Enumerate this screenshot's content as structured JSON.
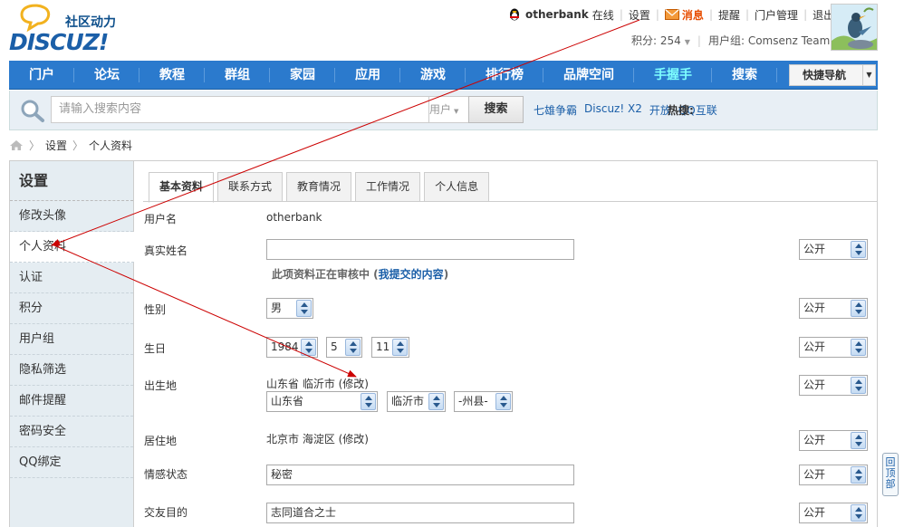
{
  "logo": {
    "tagline": "社区动力",
    "wordmark": "DISCUZ!"
  },
  "topbar": {
    "username": "otherbank",
    "online": "在线",
    "settings": "设置",
    "messages": "消息",
    "reminders": "提醒",
    "portal_manage": "门户管理",
    "logout": "退出"
  },
  "userinfo": {
    "points_label": "积分: 254",
    "usergroup_label": "用户组: Comsenz Team"
  },
  "nav": {
    "items": [
      "门户",
      "论坛",
      "教程",
      "群组",
      "家园",
      "应用",
      "游戏",
      "排行榜",
      "品牌空间",
      "手握手",
      "搜索"
    ],
    "quick_nav": "快捷导航"
  },
  "search": {
    "placeholder": "请输入搜索内容",
    "type": "用户",
    "button": "搜索",
    "hot_label": "热搜:",
    "hot_words": [
      "七雄争霸",
      "Discuz! X2",
      "开放",
      "QQ互联"
    ]
  },
  "breadcrumb": {
    "items": [
      "设置",
      "个人资料"
    ]
  },
  "sidebar": {
    "title": "设置",
    "items": [
      "修改头像",
      "个人资料",
      "认证",
      "积分",
      "用户组",
      "隐私筛选",
      "邮件提醒",
      "密码安全",
      "QQ绑定"
    ],
    "active_index": 1
  },
  "tabs": [
    "基本资料",
    "联系方式",
    "教育情况",
    "工作情况",
    "个人信息"
  ],
  "form": {
    "username": {
      "label": "用户名",
      "value": "otherbank"
    },
    "realname": {
      "label": "真实姓名",
      "value": "",
      "privacy": "公开",
      "review_prefix": "此项资料正在审核中 (",
      "review_link": "我提交的内容",
      "review_suffix": ")"
    },
    "gender": {
      "label": "性别",
      "value": "男",
      "privacy": "公开"
    },
    "birthday": {
      "label": "生日",
      "year": "1984",
      "month": "5",
      "day": "11",
      "privacy": "公开"
    },
    "birthplace": {
      "label": "出生地",
      "text": "山东省 临沂市 (修改)",
      "province": "山东省",
      "city": "临沂市",
      "county": "-州县-",
      "privacy": "公开"
    },
    "residence": {
      "label": "居住地",
      "text": "北京市 海淀区 (修改)",
      "privacy": "公开"
    },
    "affective": {
      "label": "情感状态",
      "value": "秘密",
      "privacy": "公开"
    },
    "purpose": {
      "label": "交友目的",
      "value": "志同道合之士",
      "privacy": "公开"
    }
  },
  "scroll_top": "回顶部",
  "colors": {
    "nav_bg": "#2b7acd",
    "sidebar_bg": "#e5edf2",
    "arrow": "#cc0000",
    "link": "#1b5fa8"
  }
}
